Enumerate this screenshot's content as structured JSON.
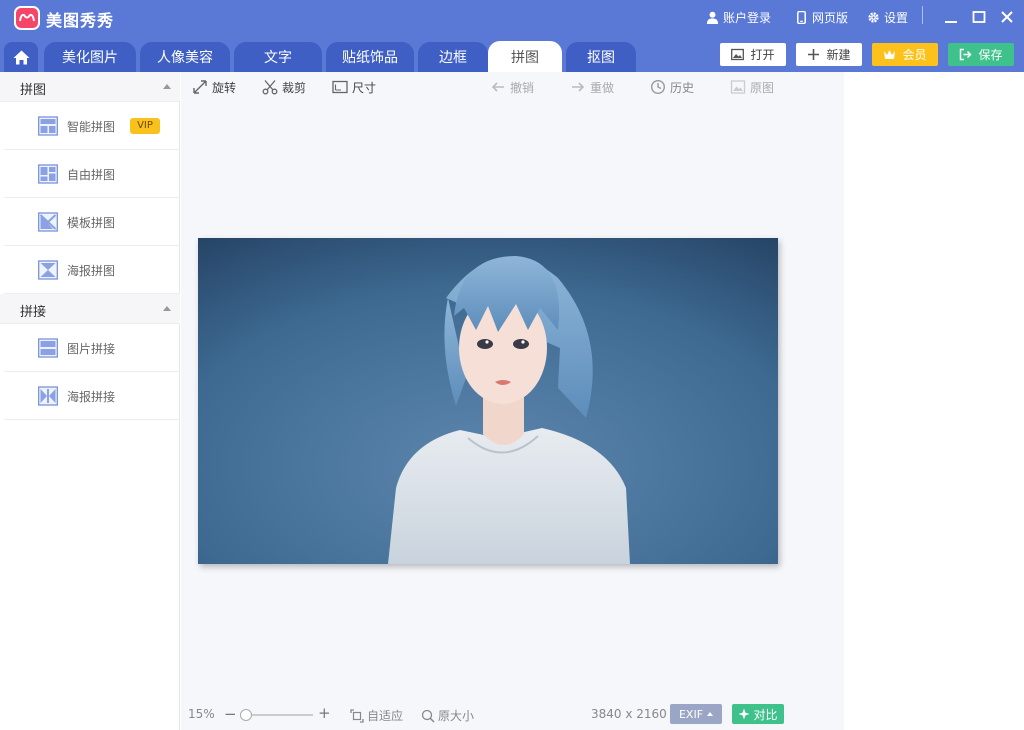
{
  "app": {
    "title": "美图秀秀"
  },
  "titlebar": {
    "login_label": "账户登录",
    "web_label": "网页版",
    "settings_label": "设置"
  },
  "tabs": [
    {
      "label": "美化图片"
    },
    {
      "label": "人像美容"
    },
    {
      "label": "文字"
    },
    {
      "label": "贴纸饰品"
    },
    {
      "label": "边框"
    },
    {
      "label": "拼图",
      "active": true
    },
    {
      "label": "抠图"
    }
  ],
  "actions": {
    "open_label": "打开",
    "new_label": "新建",
    "vip_label": "会员",
    "save_label": "保存"
  },
  "sidebar": {
    "sections": [
      {
        "title": "拼图",
        "items": [
          {
            "label": "智能拼图",
            "icon": "smart-collage-icon",
            "badge": "VIP"
          },
          {
            "label": "自由拼图",
            "icon": "free-collage-icon"
          },
          {
            "label": "模板拼图",
            "icon": "template-collage-icon"
          },
          {
            "label": "海报拼图",
            "icon": "poster-collage-icon"
          }
        ]
      },
      {
        "title": "拼接",
        "items": [
          {
            "label": "图片拼接",
            "icon": "image-stitch-icon"
          },
          {
            "label": "海报拼接",
            "icon": "poster-stitch-icon"
          }
        ]
      }
    ]
  },
  "toolbar": {
    "rotate_label": "旋转",
    "crop_label": "裁剪",
    "size_label": "尺寸",
    "undo_label": "撤销",
    "redo_label": "重做",
    "history_label": "历史",
    "original_label": "原图"
  },
  "status": {
    "zoom": "15%",
    "zoom_level": 0.15,
    "fit_label": "自适应",
    "actual_size_label": "原大小",
    "dimensions": "3840 x 2160",
    "exif_label": "EXIF",
    "compare_label": "对比"
  },
  "colors": {
    "titlebar": "#5a78d6",
    "tab_inactive": "#3f5fc4",
    "vip_gold": "#fcc21b",
    "save_green": "#3fc18c",
    "canvas_bg": "#f6f7fb"
  }
}
